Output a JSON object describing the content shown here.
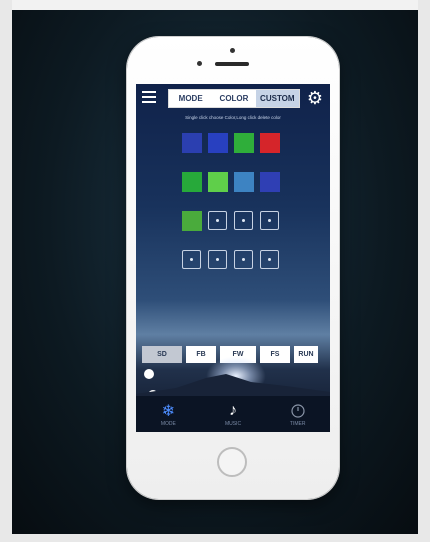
{
  "app": {
    "tabs": [
      {
        "label": "MODE",
        "active": false
      },
      {
        "label": "COLOR",
        "active": false
      },
      {
        "label": "CUSTOM",
        "active": true
      }
    ],
    "hint": "Single click choose Color,Long click delete color",
    "swatch_rows": [
      [
        "#2b3fb0",
        "#2840c0",
        "#2fae3a",
        "#d5252a"
      ],
      [
        "#27a93a",
        "#5fcf4a",
        "#3d83c2",
        "#2f3fb4"
      ],
      [
        "#4aab3c",
        "empty",
        "empty",
        "empty"
      ],
      [
        "empty",
        "empty",
        "empty",
        "empty"
      ]
    ],
    "mode_buttons": [
      {
        "label": "SD",
        "selected": true
      },
      {
        "label": "FB",
        "selected": false
      },
      {
        "label": "FW",
        "selected": false
      },
      {
        "label": "FS",
        "selected": false
      },
      {
        "label": "RUN",
        "selected": false
      }
    ],
    "bottom_tabs": [
      {
        "label": "MODE",
        "icon": "snowflake-icon"
      },
      {
        "label": "MUSIC",
        "icon": "music-note-icon"
      },
      {
        "label": "TIMER",
        "icon": "timer-icon"
      }
    ],
    "colors": {
      "accent": "#4d8dff",
      "tab_active_bg": "#c6d3e6",
      "screen_top": "#10224a"
    }
  }
}
